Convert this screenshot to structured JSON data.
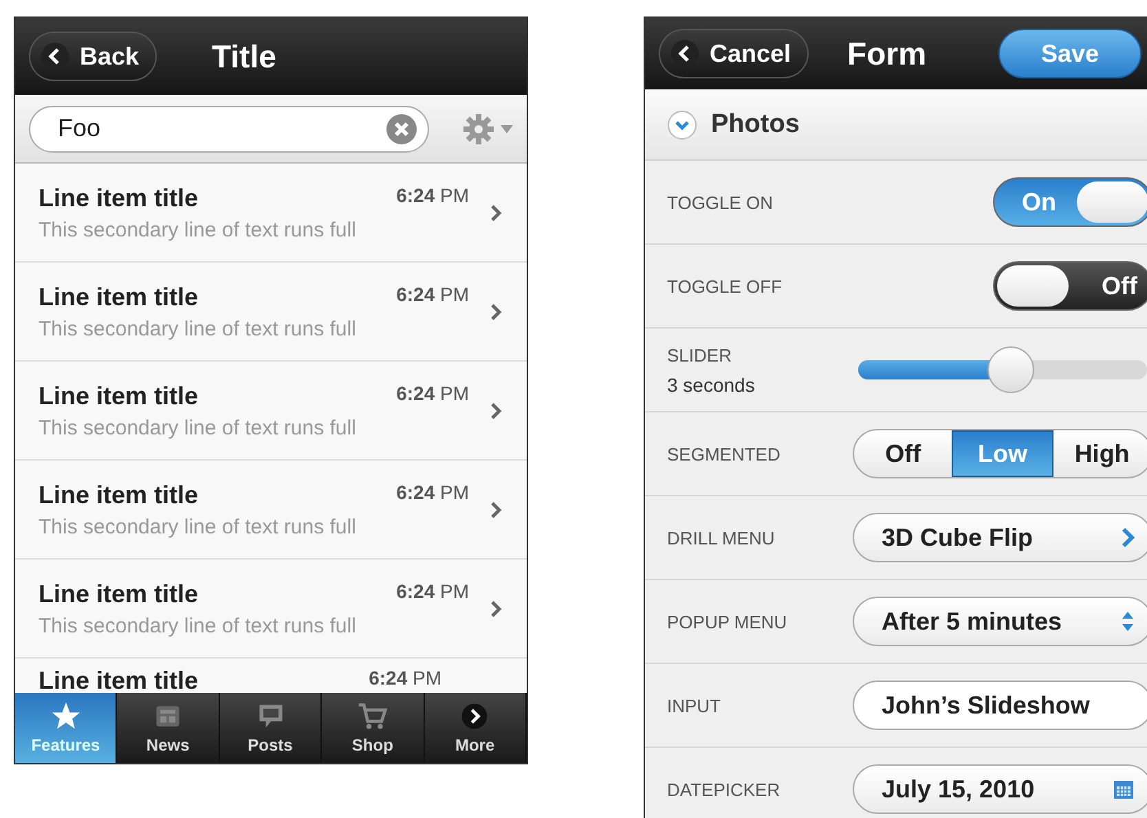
{
  "list_screen": {
    "back_button": "Back",
    "title": "Title",
    "search": {
      "value": "Foo"
    },
    "items": [
      {
        "kind": "full",
        "title": "Line item title",
        "time": "**6:24** PM",
        "subtitle": "This secondary line of text runs full"
      },
      {
        "kind": "full",
        "title": "Line item title",
        "time": "**6:24** PM",
        "subtitle": "This secondary line of text runs full"
      },
      {
        "kind": "full",
        "title": "Line item title",
        "time": "**6:24** PM",
        "subtitle": "This secondary line of text runs full"
      },
      {
        "kind": "full",
        "title": "Line item title",
        "time": "**6:24** PM",
        "subtitle": "This secondary line of text runs full"
      },
      {
        "kind": "full",
        "title": "Line item title",
        "time": "**6:24** PM",
        "subtitle": "This secondary line of text runs full"
      },
      {
        "kind": "partial",
        "title": "Line item title",
        "time": "**6:24** PM"
      }
    ],
    "tab_bar": [
      {
        "label": "Features",
        "selected": true
      },
      {
        "label": "News",
        "selected": false
      },
      {
        "label": "Posts",
        "selected": false
      },
      {
        "label": "Shop",
        "selected": false
      },
      {
        "label": "More",
        "selected": false
      }
    ]
  },
  "form_screen": {
    "cancel_button": "Cancel",
    "title": "Form",
    "save_button": "Save",
    "section": {
      "title": "Photos",
      "expanded": true
    },
    "rows": [
      {
        "kind": "toggle",
        "label": "TOGGLE ON",
        "on": true,
        "text": "On"
      },
      {
        "kind": "toggle",
        "label": "TOGGLE OFF",
        "on": false,
        "text": "Off"
      },
      {
        "kind": "slider",
        "label": "SLIDER",
        "sublabel": "3 seconds",
        "level": 0.53
      },
      {
        "kind": "segmented",
        "label": "SEGMENTED",
        "options": [
          {
            "label": "Off",
            "selected": false
          },
          {
            "label": "Low",
            "selected": true
          },
          {
            "label": "High",
            "selected": false
          }
        ]
      },
      {
        "kind": "drill",
        "label": "DRILL MENU",
        "value": "3D Cube Flip"
      },
      {
        "kind": "popup",
        "label": "POPUP MENU",
        "value": "After 5 minutes"
      },
      {
        "kind": "input",
        "label": "INPUT",
        "value": "John’s Slideshow"
      },
      {
        "kind": "date",
        "label": "DATEPICKER",
        "value": "July 15, 2010"
      }
    ]
  }
}
